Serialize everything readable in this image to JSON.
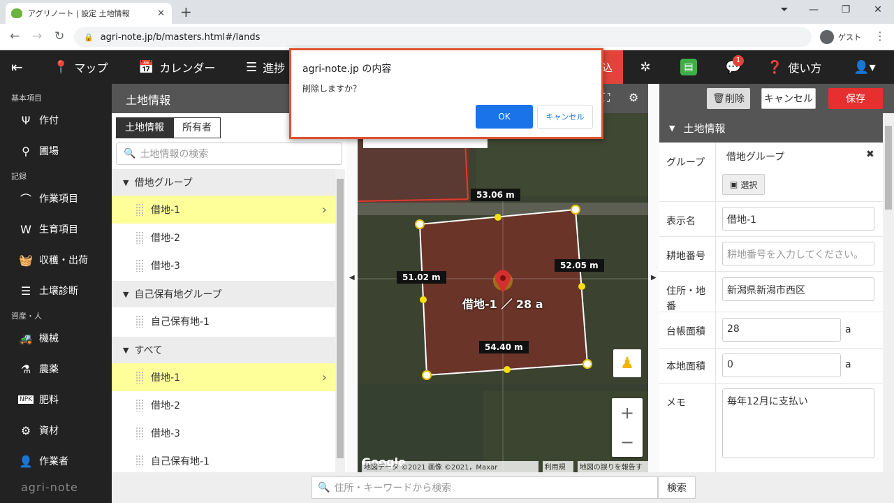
{
  "browser": {
    "tab_title": "アグリノート | 設定 土地情報",
    "new_tab": "+",
    "url": "agri-note.jp/b/masters.html#/lands",
    "profile_label": "ゲスト"
  },
  "navbar": {
    "items": [
      {
        "label": "マップ"
      },
      {
        "label": "カレンダー"
      },
      {
        "label": "進捗"
      }
    ],
    "red_button_label": "込",
    "notification_count": "1",
    "help_label": "使い方"
  },
  "sidebar": {
    "sections": [
      {
        "label": "基本項目"
      },
      {
        "label": "記録"
      },
      {
        "label": "資産・人"
      }
    ],
    "items": [
      {
        "label": "作付"
      },
      {
        "label": "圃場"
      },
      {
        "label": "作業項目"
      },
      {
        "label": "生育項目"
      },
      {
        "label": "収穫・出荷"
      },
      {
        "label": "土壌診断"
      },
      {
        "label": "機械"
      },
      {
        "label": "農薬"
      },
      {
        "label": "肥料"
      },
      {
        "label": "資材"
      },
      {
        "label": "作業者"
      }
    ],
    "logo": "agri-note"
  },
  "list_panel": {
    "title": "土地情報",
    "tabs": [
      "土地情報",
      "所有者"
    ],
    "search_placeholder": "土地情報の検索",
    "groups": [
      {
        "name": "借地グループ",
        "items": [
          "借地-1",
          "借地-2",
          "借地-3"
        ]
      },
      {
        "name": "自己保有地グループ",
        "items": [
          "自己保有地-1"
        ]
      },
      {
        "name": "すべて",
        "items": [
          "借地-1",
          "借地-2",
          "借地-3",
          "自己保有地-1"
        ]
      }
    ]
  },
  "map": {
    "distances": [
      "53.06 m",
      "51.02 m",
      "52.05 m",
      "54.40 m"
    ],
    "land_label": "借地-1 ／ 28 a",
    "google": "Google",
    "attribution": [
      "地図データ ©2021 画像 ©2021，Maxar Technologies",
      "利用規約",
      "地図の誤りを報告する"
    ],
    "zoom_in": "+",
    "zoom_out": "−"
  },
  "detail_panel": {
    "delete_label": "削除",
    "cancel_label": "キャンセル",
    "save_label": "保存",
    "section_title": "土地情報",
    "fields": {
      "group_label": "グループ",
      "group_value": "借地グループ",
      "select_label": "選択",
      "display_name_label": "表示名",
      "display_name_value": "借地-1",
      "lot_number_label": "耕地番号",
      "lot_number_placeholder": "耕地番号を入力してください。",
      "address_label": "住所・地番",
      "address_value": "新潟県新潟市西区",
      "ledger_area_label": "台帳面積",
      "ledger_area_value": "28",
      "actual_area_label": "本地面積",
      "actual_area_value": "0",
      "unit": "a",
      "memo_label": "メモ",
      "memo_value": "毎年12月に支払い"
    }
  },
  "bottom_bar": {
    "search_placeholder": "住所・キーワードから検索",
    "search_button": "検索"
  },
  "dialog": {
    "title": "agri-note.jp の内容",
    "message": "削除しますか？",
    "ok_label": "OK",
    "cancel_label": "キャンセル"
  }
}
